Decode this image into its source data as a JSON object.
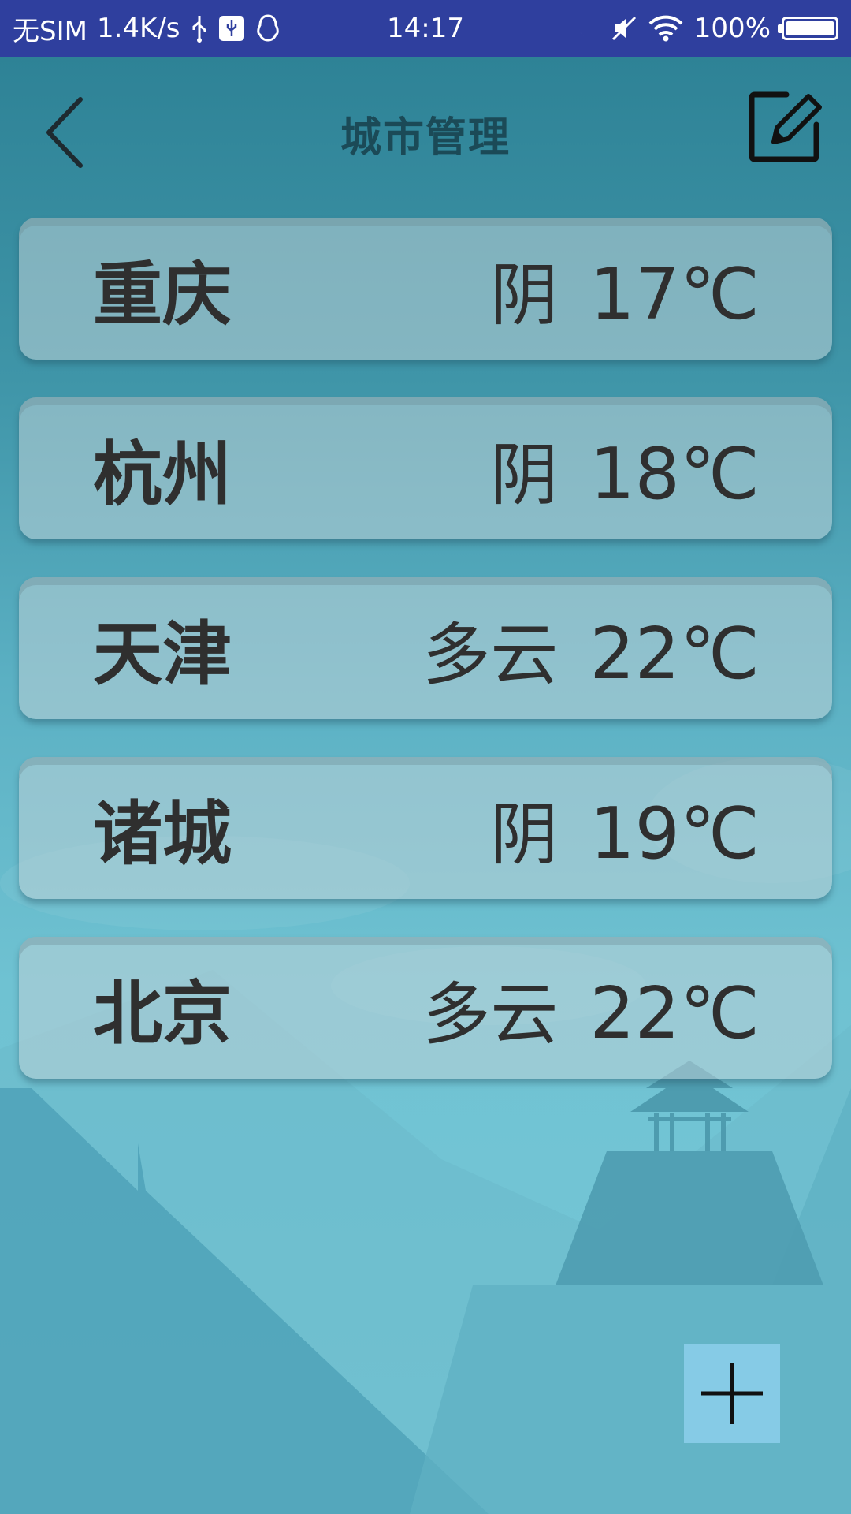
{
  "statusbar": {
    "carrier": "无SIM",
    "speed": "1.4K/s",
    "time": "14:17",
    "battery": "100%",
    "left_icons": [
      "usb-icon",
      "usb-debug-icon",
      "qq-icon"
    ],
    "right_icons": [
      "moon-icon",
      "mute-icon",
      "wifi-icon",
      "battery-icon"
    ]
  },
  "header": {
    "title": "城市管理",
    "back_icon": "chevron-left-icon",
    "edit_icon": "edit-icon"
  },
  "cities": [
    {
      "name": "重庆",
      "weather": "阴",
      "temp": "17℃"
    },
    {
      "name": "杭州",
      "weather": "阴",
      "temp": "18℃"
    },
    {
      "name": "天津",
      "weather": "多云",
      "temp": "22℃"
    },
    {
      "name": "诸城",
      "weather": "阴",
      "temp": "19℃"
    },
    {
      "name": "北京",
      "weather": "多云",
      "temp": "22℃"
    }
  ],
  "fab": {
    "icon": "plus-icon"
  },
  "colors": {
    "statusbar": "#2f3f9e",
    "bg_top": "#2b7f93",
    "bg_bottom": "#77c8d8",
    "fab": "#86cbe6",
    "text": "#2f2f2f"
  }
}
